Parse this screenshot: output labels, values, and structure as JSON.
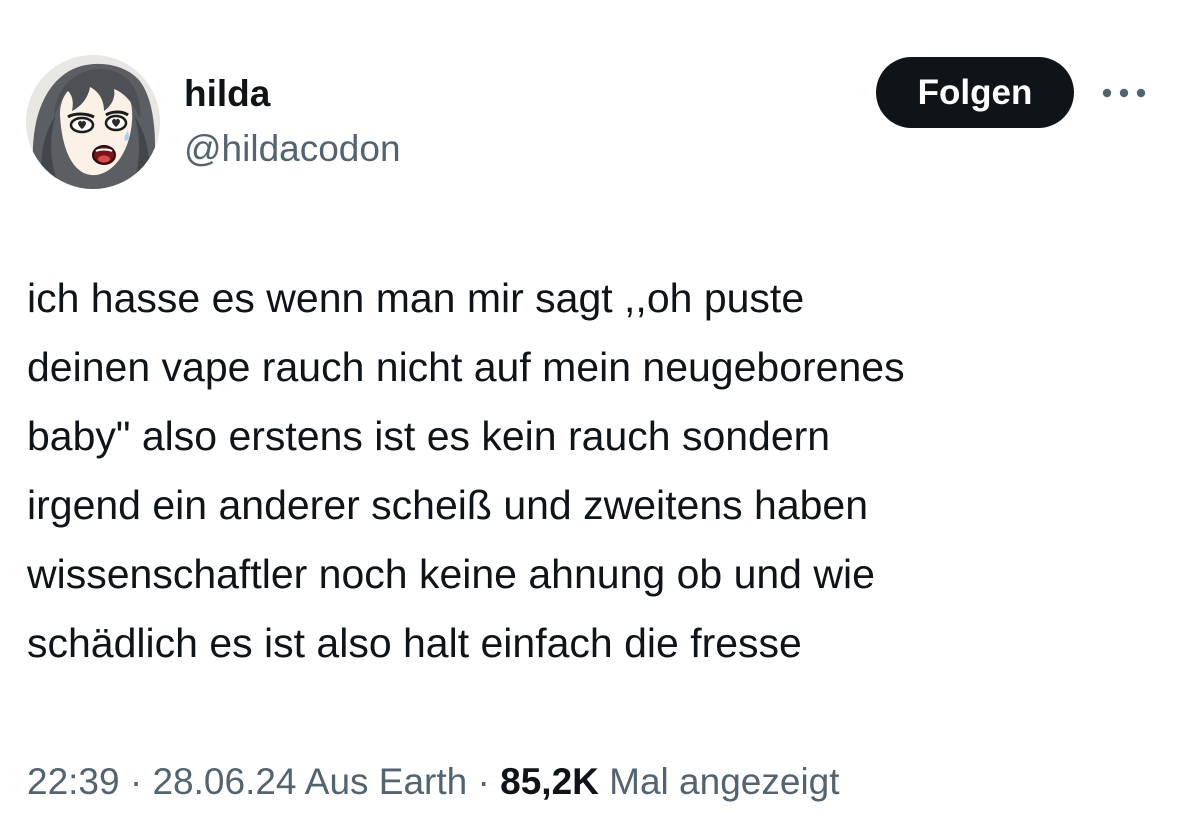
{
  "author": {
    "display_name": "hilda",
    "handle": "@hildacodon",
    "avatar_icon": "anime-avatar-icon"
  },
  "actions": {
    "follow_label": "Folgen",
    "more_icon": "more-options-icon"
  },
  "tweet": {
    "text": "ich hasse es wenn man mir sagt ,,oh puste\ndeinen vape rauch nicht auf mein neugeborenes\nbaby\" also erstens ist es kein rauch sondern\nirgend ein anderer scheiß und zweitens haben\nwissenschaftler noch keine ahnung ob und wie\nschädlich es ist also halt einfach die fresse"
  },
  "meta": {
    "time": "22:39",
    "separator": " · ",
    "date": "28.06.24",
    "location": "Aus Earth",
    "views_count": "85,2K",
    "views_label": "Mal angezeigt"
  },
  "colors": {
    "text_primary": "#0f1419",
    "text_secondary": "#536471",
    "button_bg": "#0f1419",
    "button_text": "#ffffff",
    "background": "#ffffff"
  }
}
